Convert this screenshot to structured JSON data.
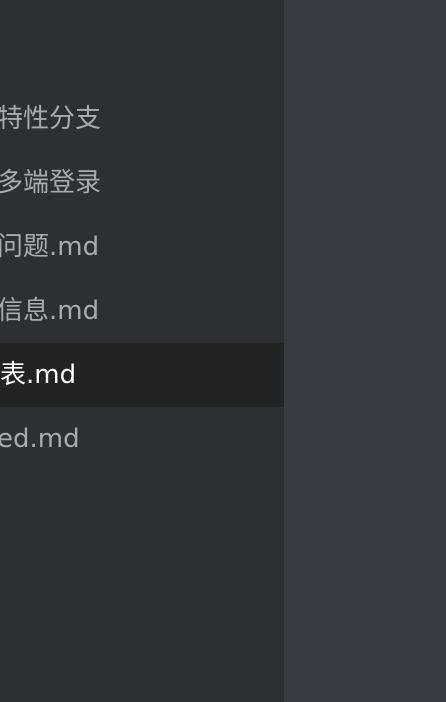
{
  "sidebar": {
    "items": [
      {
        "label": "特性分支",
        "active": false
      },
      {
        "label": "多端登录",
        "active": false
      },
      {
        "label": "问题.md",
        "active": false
      },
      {
        "label": "信息.md",
        "active": false
      },
      {
        "label": "表.md",
        "active": true
      },
      {
        "label": "ed.md",
        "active": false
      }
    ]
  },
  "colors": {
    "sidebar_bg": "#2e2f32",
    "active_row_bg": "#232324",
    "editor_bg": "#383b40",
    "text": "#a9abae",
    "active_text": "#ffffff"
  }
}
